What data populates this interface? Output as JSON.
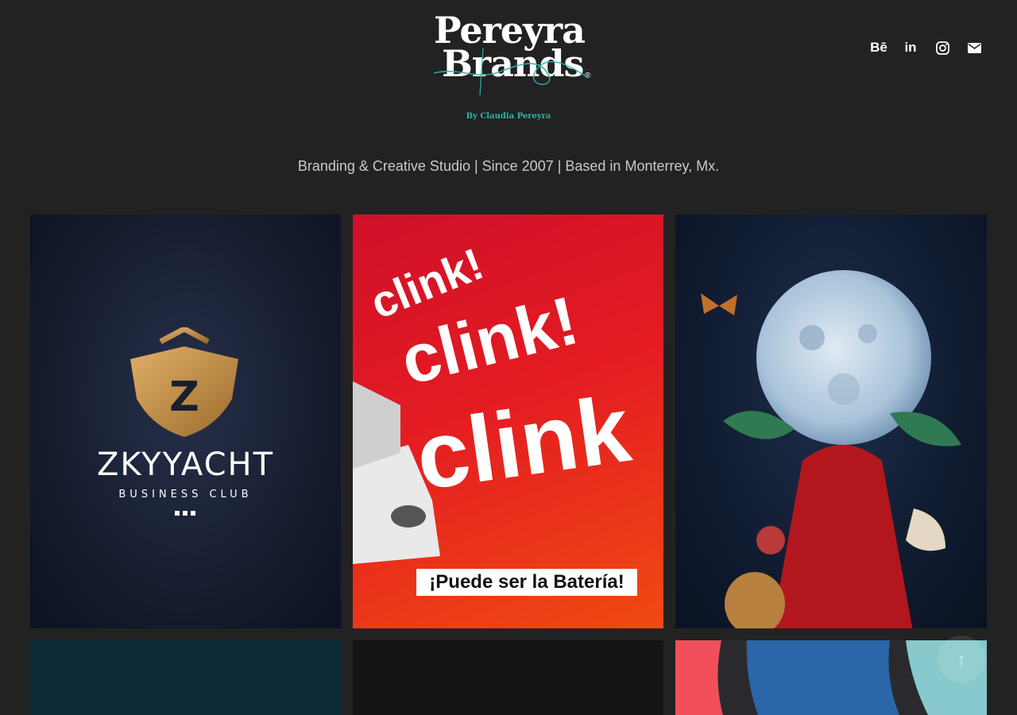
{
  "brand": {
    "logo_line1": "Pereyra",
    "logo_line2": "Brands",
    "logo_reg": "®",
    "byline": "By Claudia Pereyra"
  },
  "social": [
    {
      "label": "Bē",
      "icon": "behance-icon"
    },
    {
      "label": "in",
      "icon": "linkedin-icon"
    },
    {
      "label": "",
      "icon": "instagram-icon"
    },
    {
      "label": "",
      "icon": "mail-icon"
    }
  ],
  "tagline": "Branding & Creative Studio | Since 2007 | Based in Monterrey, Mx.",
  "projects": [
    {
      "name": "ZKYYACHT",
      "subtitle": "BUSINESS CLUB",
      "mark": "Z"
    },
    {
      "words": [
        "clink!",
        "clink!",
        "clink"
      ],
      "banner": "¡Puede ser la Batería!"
    },
    {
      "theme": "moon-collage"
    },
    {
      "theme": "teal"
    },
    {
      "theme": "dark-texture"
    },
    {
      "theme": "stripes"
    }
  ],
  "colors": {
    "background": "#222222",
    "accent": "#2bb3a8",
    "text": "#c9c9c9"
  },
  "scroll_top_icon": "↑"
}
